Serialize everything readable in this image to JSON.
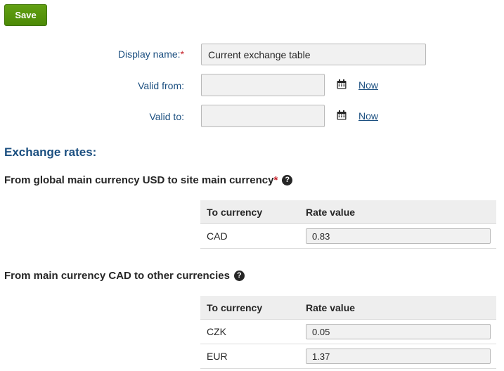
{
  "toolbar": {
    "save_label": "Save"
  },
  "form": {
    "display_name": {
      "label": "Display name:",
      "required_mark": "*",
      "value": "Current exchange table"
    },
    "valid_from": {
      "label": "Valid from:",
      "value": "",
      "now_label": "Now",
      "calendar_icon": "calendar-icon"
    },
    "valid_to": {
      "label": "Valid to:",
      "value": "",
      "now_label": "Now",
      "calendar_icon": "calendar-icon"
    }
  },
  "exchange": {
    "heading": "Exchange rates:",
    "global": {
      "title": "From global main currency USD to site main currency",
      "required_mark": "*",
      "help_icon": "help-icon",
      "columns": [
        "To currency",
        "Rate value"
      ],
      "rows": [
        {
          "currency": "CAD",
          "rate": "0.83"
        }
      ]
    },
    "main": {
      "title": "From main currency CAD to other currencies",
      "help_icon": "help-icon",
      "columns": [
        "To currency",
        "Rate value"
      ],
      "rows": [
        {
          "currency": "CZK",
          "rate": "0.05"
        },
        {
          "currency": "EUR",
          "rate": "1.37"
        }
      ]
    }
  },
  "colors": {
    "save_button": "#4c8a06",
    "label_blue": "#1b4f80",
    "required_red": "#c6262e",
    "table_header_bg": "#eeeeee"
  }
}
